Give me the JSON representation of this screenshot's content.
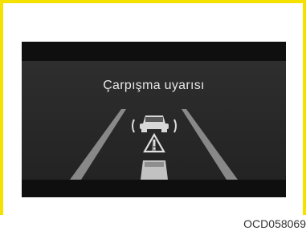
{
  "display": {
    "title": "Çarpışma uyarısı",
    "icons": [
      "road-lanes",
      "vehicle-ahead-icon",
      "warning-triangle-icon",
      "own-vehicle-icon"
    ]
  },
  "figure_code": "OCD058069",
  "colors": {
    "frame_border": "#f5e100",
    "screen": "#181818",
    "text": "#e6e6e6"
  }
}
